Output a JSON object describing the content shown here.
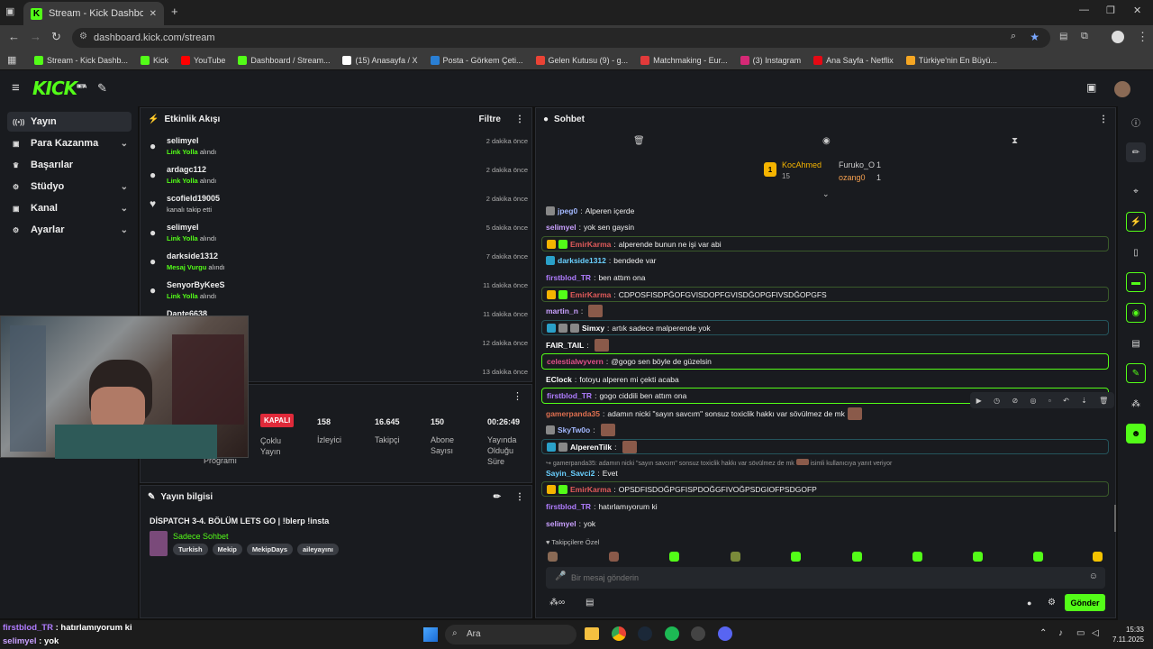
{
  "browser": {
    "tab_title": "Stream - Kick Dashboard",
    "url": "dashboard.kick.com/stream",
    "bookmarks": [
      {
        "label": "Stream - Kick Dashb...",
        "color": "#53fc18"
      },
      {
        "label": "Kick",
        "color": "#53fc18"
      },
      {
        "label": "YouTube",
        "color": "#ff0000"
      },
      {
        "label": "Dashboard / Stream...",
        "color": "#53fc18"
      },
      {
        "label": "(15) Anasayfa / X",
        "color": "#ffffff"
      },
      {
        "label": "Posta - Görkem Çeti...",
        "color": "#2a7fd4"
      },
      {
        "label": "Gelen Kutusu (9) - g...",
        "color": "#ea4335"
      },
      {
        "label": "Matchmaking - Eur...",
        "color": "#e23a3a"
      },
      {
        "label": "(3) Instagram",
        "color": "#d62976"
      },
      {
        "label": "Ana Sayfa - Netflix",
        "color": "#e50914"
      },
      {
        "label": "Türkiye'nin En Büyü...",
        "color": "#f5a623"
      }
    ]
  },
  "header": {
    "logo": "KICK",
    "logo_sup": "BETA"
  },
  "nav": [
    {
      "label": "Yayın",
      "icon": "broadcast-icon",
      "active": true,
      "chev": false
    },
    {
      "label": "Para Kazanma",
      "icon": "money-icon",
      "active": false,
      "chev": true
    },
    {
      "label": "Başarılar",
      "icon": "trophy-icon",
      "active": false,
      "chev": false
    },
    {
      "label": "Stüdyo",
      "icon": "studio-icon",
      "active": false,
      "chev": true
    },
    {
      "label": "Kanal",
      "icon": "channel-icon",
      "active": false,
      "chev": true
    },
    {
      "label": "Ayarlar",
      "icon": "settings-icon",
      "active": false,
      "chev": true
    }
  ],
  "activity": {
    "title": "Etkinlik Akışı",
    "filter": "Filtre",
    "items": [
      {
        "user": "selimyel",
        "hl": "Link Yolla",
        "rest": " alındı",
        "time": "2 dakika önce",
        "icon": "●"
      },
      {
        "user": "ardagc112",
        "hl": "Link Yolla",
        "rest": " alındı",
        "time": "2 dakika önce",
        "icon": "●"
      },
      {
        "user": "scofield19005",
        "hl": "",
        "rest": "kanalı takip etti",
        "time": "2 dakika önce",
        "icon": "♥"
      },
      {
        "user": "selimyel",
        "hl": "Link Yolla",
        "rest": " alındı",
        "time": "5 dakika önce",
        "icon": "●"
      },
      {
        "user": "darkside1312",
        "hl": "Mesaj Vurgu",
        "rest": " alındı",
        "time": "7 dakika önce",
        "icon": "●"
      },
      {
        "user": "SenyorByKeeS",
        "hl": "Link Yolla",
        "rest": " alındı",
        "time": "11 dakika önce",
        "icon": "●"
      },
      {
        "user": "Dante6638",
        "hl": "",
        "rest": "",
        "time": "11 dakika önce",
        "icon": "●"
      },
      {
        "user": "",
        "hl": "",
        "rest": "",
        "time": "12 dakika önce",
        "icon": ""
      },
      {
        "user": "",
        "hl": "",
        "rest": "",
        "time": "13 dakika önce",
        "icon": ""
      }
    ]
  },
  "stats": {
    "status": "KAPALI",
    "program_label": "Programı",
    "multi_label": "Çoklu Yayın",
    "viewers": "158",
    "viewers_label": "İzleyici",
    "followers": "16.645",
    "followers_label": "Takipçi",
    "subs": "150",
    "subs_label": "Abone Sayısı",
    "uptime": "00:26:49",
    "uptime_label": "Yayında Olduğu Süre"
  },
  "stream_info": {
    "title_label": "Yayın bilgisi",
    "stream_title": "DİSPATCH 3-4. BÖLÜM LETS GO | !blerp !insta",
    "mode": "Sadece Sohbet",
    "tags": [
      "Turkish",
      "Mekip",
      "MekipDays",
      "aileyayını"
    ]
  },
  "chat": {
    "title": "Sohbet",
    "top_user": "KocAhmed",
    "top_user_count": "15",
    "second_user": "Furuko_O",
    "second_count": "1",
    "third_user": "ozang0",
    "third_count": "1",
    "messages": [
      {
        "user": "jpeg0",
        "color": "#a3b8ff",
        "text": "Alperen içerde",
        "style": "",
        "badges": [
          "#888"
        ]
      },
      {
        "user": "selimyel",
        "color": "#c9a0ff",
        "text": "yok sen gaysin",
        "style": "",
        "badges": []
      },
      {
        "user": "EmirKarma",
        "color": "#e05a5a",
        "text": "alperende bunun ne işi var abi",
        "style": "hl",
        "badges": [
          "#f5b400",
          "#53fc18"
        ]
      },
      {
        "user": "darkside1312",
        "color": "#6ad0ff",
        "text": "bendede var",
        "style": "",
        "badges": [
          "#2aa0c8"
        ]
      },
      {
        "user": "firstblod_TR",
        "color": "#b07cff",
        "text": "ben attım ona",
        "style": "",
        "badges": []
      },
      {
        "user": "EmirKarma",
        "color": "#e05a5a",
        "text": "CDPOSFISDPĞOFGVISDOPFGVISDĞOPGFIVSDĞOPGFS",
        "style": "hl",
        "badges": [
          "#f5b400",
          "#53fc18"
        ]
      },
      {
        "user": "martin_n",
        "color": "#c9a0ff",
        "text": "",
        "style": "",
        "badges": [],
        "emote": true
      },
      {
        "user": "Simxy",
        "color": "#ffffff",
        "text": "artık sadece malperende yok",
        "style": "hlc",
        "badges": [
          "#2aa0c8",
          "#888",
          "#888"
        ]
      },
      {
        "user": "FAIR_TAIL",
        "color": "#ffffff",
        "text": "",
        "style": "",
        "badges": [],
        "emote": true
      },
      {
        "user": "celestialwyvern",
        "color": "#e0508a",
        "text": "@gogo sen böyle de güzelsin",
        "style": "hlg",
        "badges": []
      },
      {
        "user": "EClock",
        "color": "#ffffff",
        "text": "fotoyu alperen mi çekti acaba",
        "style": "",
        "badges": []
      },
      {
        "user": "firstblod_TR",
        "color": "#b07cff",
        "text": "gogo ciddili ben attım ona",
        "style": "hlg",
        "badges": []
      },
      {
        "user": "gamerpanda35",
        "color": "#e07050",
        "text": "adamın nicki \"sayın savcım\" sonsuz toxiclik hakkı var sövülmez de mk",
        "style": "",
        "badges": [],
        "emote": true
      },
      {
        "user": "SkyTw0o",
        "color": "#a3b8ff",
        "text": "",
        "style": "",
        "badges": [
          "#888"
        ],
        "emote": true
      },
      {
        "user": "AlperenTilk",
        "color": "#ffffff",
        "text": "",
        "style": "hlc",
        "badges": [
          "#2aa0c8",
          "#888"
        ],
        "emote": true
      },
      {
        "user": "Sayin_Savci2",
        "color": "#6ad0ff",
        "text": "Evet",
        "style": "",
        "badges": []
      },
      {
        "user": "EmirKarma",
        "color": "#e05a5a",
        "text": "OPSDFISDOĞPGFISPDOĞGFIVOĞPSDGIOFPSDGOFP",
        "style": "hl",
        "badges": [
          "#f5b400",
          "#53fc18"
        ]
      },
      {
        "user": "firstblod_TR",
        "color": "#b07cff",
        "text": "hatırlamıyorum ki",
        "style": "",
        "badges": []
      },
      {
        "user": "selimyel",
        "color": "#c9a0ff",
        "text": "yok",
        "style": "",
        "badges": []
      }
    ],
    "reply_preview": "gamerpanda35: adamın nicki \"sayın savcım\" sonsuz toxiclik hakkı var sövülmez de mk",
    "reply_suffix": "isimli kullanıcıya yanıt veriyor",
    "followers_only": "Takipçilere Özel",
    "placeholder": "Bir mesaj gönderin",
    "send": "Gönder"
  },
  "overlay": {
    "line1_user": "firstblod_TR",
    "line1_text": " : hatırlamıyorum ki",
    "line2_user": "selimyel",
    "line2_text": " : yok"
  },
  "taskbar": {
    "search": "Ara",
    "time": "15:33",
    "date": "7.11.2025"
  },
  "colors": {
    "accent": "#53fc18",
    "bg": "#191b1f",
    "panel_border": "#2a2d33"
  }
}
